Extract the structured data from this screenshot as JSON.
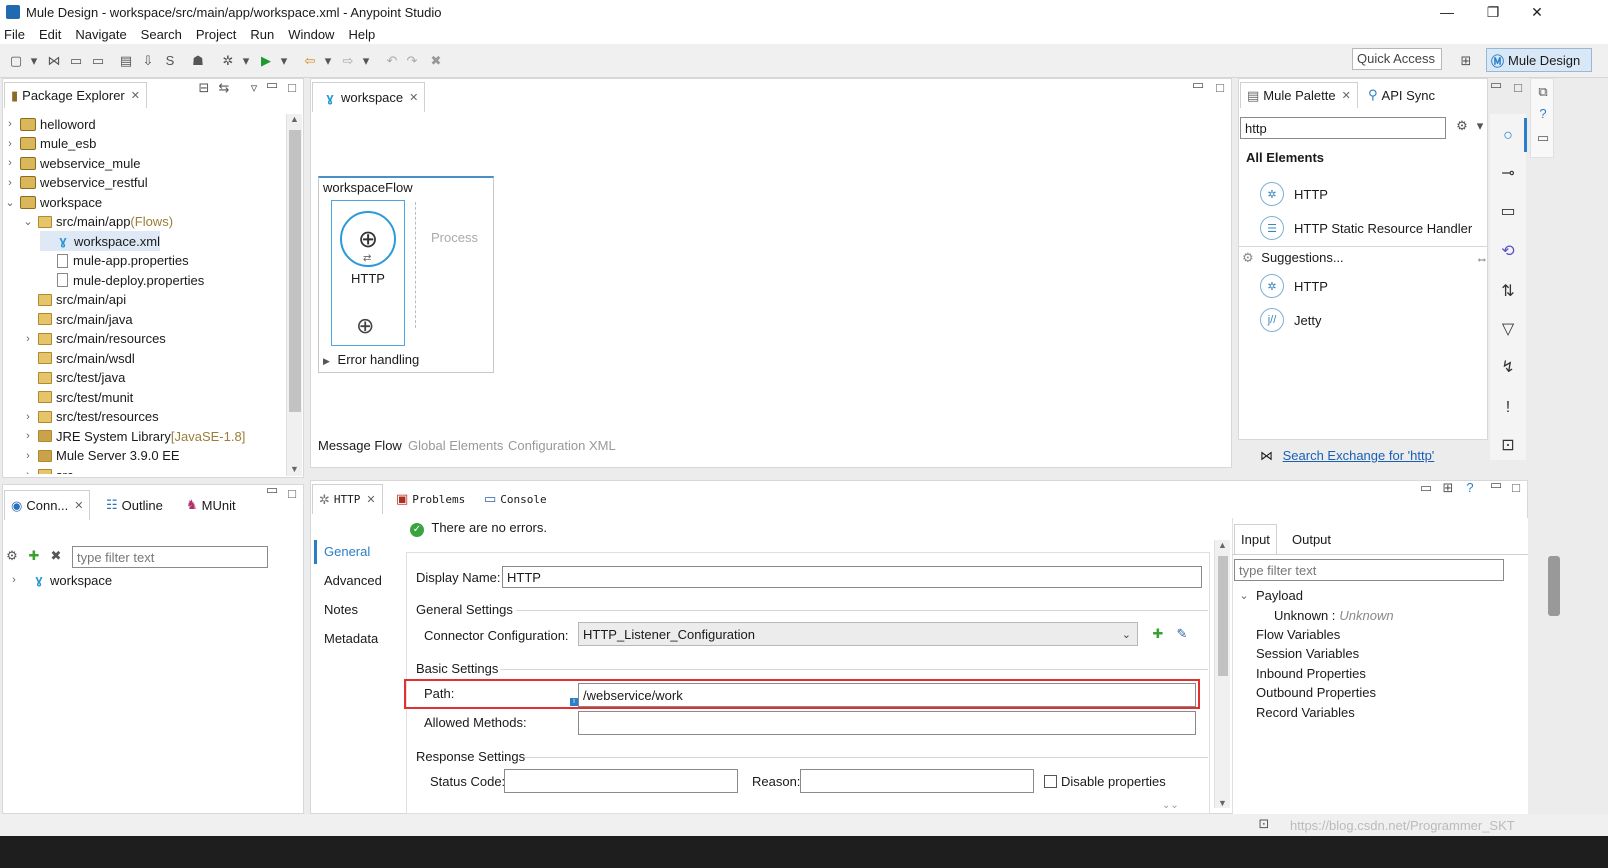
{
  "window": {
    "title": "Mule Design - workspace/src/main/app/workspace.xml - Anypoint Studio",
    "minimize": "—",
    "maximize": "❐",
    "close": "✕"
  },
  "menu": [
    "File",
    "Edit",
    "Navigate",
    "Search",
    "Project",
    "Run",
    "Window",
    "Help"
  ],
  "toolbar": {
    "quick_access": "Quick Access",
    "perspective": "Mule Design"
  },
  "package_explorer": {
    "tab_label": "Package Explorer",
    "items": [
      {
        "label": "helloword",
        "level": 0,
        "arrow": "›",
        "icon": "project"
      },
      {
        "label": "mule_esb",
        "level": 0,
        "arrow": "›",
        "icon": "project"
      },
      {
        "label": "webservice_mule",
        "level": 0,
        "arrow": "›",
        "icon": "project"
      },
      {
        "label": "webservice_restful",
        "level": 0,
        "arrow": "›",
        "icon": "project"
      },
      {
        "label": "workspace",
        "level": 0,
        "arrow": "⌄",
        "icon": "project"
      },
      {
        "label": "src/main/app",
        "suffix": " (Flows)",
        "level": 1,
        "arrow": "⌄",
        "icon": "folder"
      },
      {
        "label": "workspace.xml",
        "level": 2,
        "arrow": "",
        "icon": "mule",
        "selected": true
      },
      {
        "label": "mule-app.properties",
        "level": 2,
        "arrow": "",
        "icon": "file"
      },
      {
        "label": "mule-deploy.properties",
        "level": 2,
        "arrow": "",
        "icon": "file"
      },
      {
        "label": "src/main/api",
        "level": 1,
        "arrow": "",
        "icon": "folder"
      },
      {
        "label": "src/main/java",
        "level": 1,
        "arrow": "",
        "icon": "folder"
      },
      {
        "label": "src/main/resources",
        "level": 1,
        "arrow": "›",
        "icon": "folder"
      },
      {
        "label": "src/main/wsdl",
        "level": 1,
        "arrow": "",
        "icon": "folder"
      },
      {
        "label": "src/test/java",
        "level": 1,
        "arrow": "",
        "icon": "folder"
      },
      {
        "label": "src/test/munit",
        "level": 1,
        "arrow": "",
        "icon": "folder"
      },
      {
        "label": "src/test/resources",
        "level": 1,
        "arrow": "›",
        "icon": "folder"
      },
      {
        "label": "JRE System Library",
        "suffix": " [JavaSE-1.8]",
        "level": 1,
        "arrow": "›",
        "icon": "lib"
      },
      {
        "label": "Mule Server 3.9.0 EE",
        "level": 1,
        "arrow": "›",
        "icon": "lib"
      },
      {
        "label": "src",
        "level": 1,
        "arrow": "›",
        "icon": "folder"
      }
    ]
  },
  "lower_left": {
    "tabs": [
      "Conn...",
      "Outline",
      "MUnit"
    ],
    "filter_placeholder": "type filter text",
    "tree_item": "workspace"
  },
  "editor": {
    "tab_label": "workspace",
    "flow_name": "workspaceFlow",
    "process_label": "Process",
    "http_label": "HTTP",
    "error_handling": "Error handling",
    "bottom_tabs": [
      "Message Flow",
      "Global Elements",
      "Configuration XML"
    ]
  },
  "palette": {
    "tabs": [
      "Mule Palette",
      "API Sync"
    ],
    "search_value": "http",
    "all_elements": "All Elements",
    "elements": [
      "HTTP",
      "HTTP Static Resource Handler"
    ],
    "suggestions_label": "Suggestions...",
    "suggestions": [
      "HTTP",
      "Jetty"
    ],
    "exchange_link": "Search Exchange for 'http'"
  },
  "properties": {
    "tabs": [
      "HTTP",
      "Problems",
      "Console"
    ],
    "status": "There are no errors.",
    "nav": [
      "General",
      "Advanced",
      "Notes",
      "Metadata"
    ],
    "display_name_label": "Display Name:",
    "display_name_value": "HTTP",
    "general_settings": "General Settings",
    "connector_config_label": "Connector Configuration:",
    "connector_config_value": "HTTP_Listener_Configuration",
    "basic_settings": "Basic Settings",
    "path_label": "Path:",
    "path_value": "/webservice/work",
    "allowed_methods_label": "Allowed Methods:",
    "response_settings": "Response Settings",
    "status_code_label": "Status Code:",
    "reason_label": "Reason:",
    "disable_properties": "Disable properties"
  },
  "metadata": {
    "tabs": [
      "Input",
      "Output"
    ],
    "filter_placeholder": "type filter text",
    "payload": "Payload",
    "unknown_label": "Unknown :",
    "unknown_value": "Unknown",
    "items": [
      "Flow Variables",
      "Session Variables",
      "Inbound Properties",
      "Outbound Properties",
      "Record Variables"
    ]
  },
  "watermark": "https://blog.csdn.net/Programmer_SKT"
}
